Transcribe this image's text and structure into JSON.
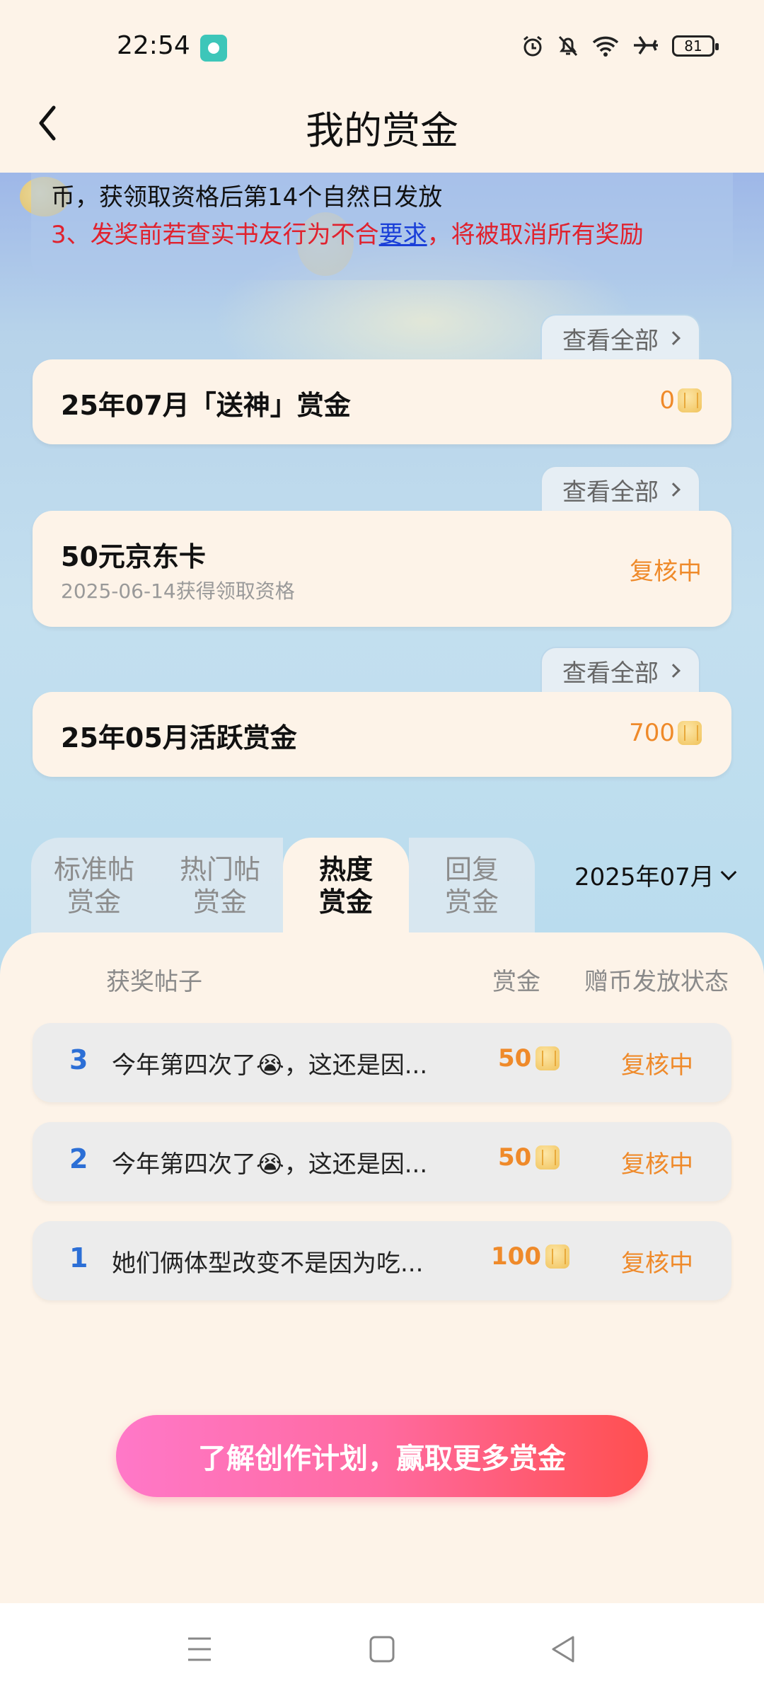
{
  "status": {
    "time": "22:54",
    "battery": "81"
  },
  "header": {
    "title": "我的赏金"
  },
  "rules": {
    "line1": "币，获领取资格后第14个自然日发放",
    "line2_prefix": "3、发奖前若查实书友行为不合",
    "line2_link": "要求",
    "line2_suffix": "，将被取消所有奖励"
  },
  "sections": [
    {
      "view_all": "查看全部",
      "title": "25年07月「送神」赏金",
      "value": "0"
    },
    {
      "view_all": "查看全部",
      "title": "50元京东卡",
      "subtitle": "2025-06-14获得领取资格",
      "status": "复核中"
    },
    {
      "view_all": "查看全部",
      "title": "25年05月活跃赏金",
      "value": "700"
    }
  ],
  "tabs": [
    {
      "line1": "标准帖",
      "line2": "赏金"
    },
    {
      "line1": "热门帖",
      "line2": "赏金"
    },
    {
      "line1": "热度",
      "line2": "赏金",
      "active": true
    },
    {
      "line1": "回复",
      "line2": "赏金"
    }
  ],
  "month_filter": "2025年07月",
  "table": {
    "headers": {
      "post": "获奖帖子",
      "reward": "赏金",
      "status": "赠币发放状态"
    },
    "rows": [
      {
        "rank": "3",
        "title": "今年第四次了😭，这还是因...",
        "amount": "50",
        "status": "复核中"
      },
      {
        "rank": "2",
        "title": "今年第四次了😭，这还是因...",
        "amount": "50",
        "status": "复核中"
      },
      {
        "rank": "1",
        "title": "她们俩体型改变不是因为吃...",
        "amount": "100",
        "status": "复核中"
      }
    ]
  },
  "cta": {
    "label": "了解创作计划，赢取更多赏金"
  },
  "colors": {
    "accent": "#ef8a2a",
    "rank": "#2c6fd6",
    "warning": "#e0222e",
    "link": "#1a3fd8"
  }
}
